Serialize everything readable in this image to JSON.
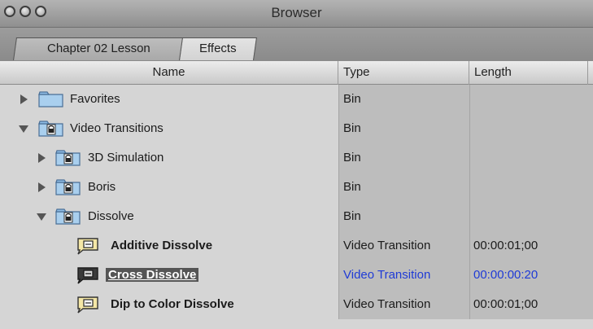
{
  "window": {
    "title": "Browser"
  },
  "tabs": [
    "Chapter 02 Lesson",
    "Effects"
  ],
  "columns": {
    "name": "Name",
    "type": "Type",
    "length": "Length"
  },
  "rows": [
    {
      "name": "Favorites",
      "type": "Bin",
      "length": ""
    },
    {
      "name": "Video Transitions",
      "type": "Bin",
      "length": ""
    },
    {
      "name": "3D Simulation",
      "type": "Bin",
      "length": ""
    },
    {
      "name": "Boris",
      "type": "Bin",
      "length": ""
    },
    {
      "name": "Dissolve",
      "type": "Bin",
      "length": ""
    },
    {
      "name": "Additive Dissolve",
      "type": "Video Transition",
      "length": "00:00:01;00"
    },
    {
      "name": "Cross Dissolve",
      "type": "Video Transition",
      "length": "00:00:00:20"
    },
    {
      "name": "Dip to Color Dissolve",
      "type": "Video Transition",
      "length": "00:00:01;00"
    }
  ],
  "colors": {
    "selection_text": "#1f3bd6",
    "selected_name_bg": "#555555"
  },
  "icons": [
    "close-icon",
    "minimize-icon",
    "zoom-icon",
    "disclosure-triangle-icon",
    "folder-icon",
    "locked-bin-icon",
    "transition-icon"
  ]
}
